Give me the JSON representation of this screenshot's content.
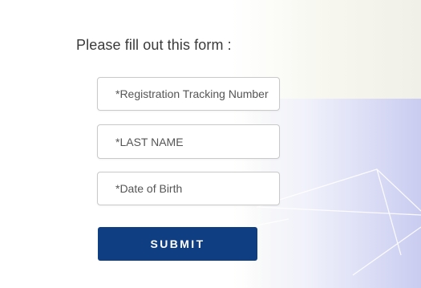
{
  "form": {
    "title": "Please fill out this form :",
    "fields": [
      {
        "placeholder": "*Registration Tracking Number",
        "value": ""
      },
      {
        "placeholder": "*LAST NAME",
        "value": ""
      },
      {
        "placeholder": "*Date of Birth",
        "value": ""
      }
    ],
    "submit_label": "SUBMIT"
  },
  "colors": {
    "submit_background": "#0f3e82",
    "submit_text": "#ffffff",
    "title_text": "#3a3a3a"
  }
}
